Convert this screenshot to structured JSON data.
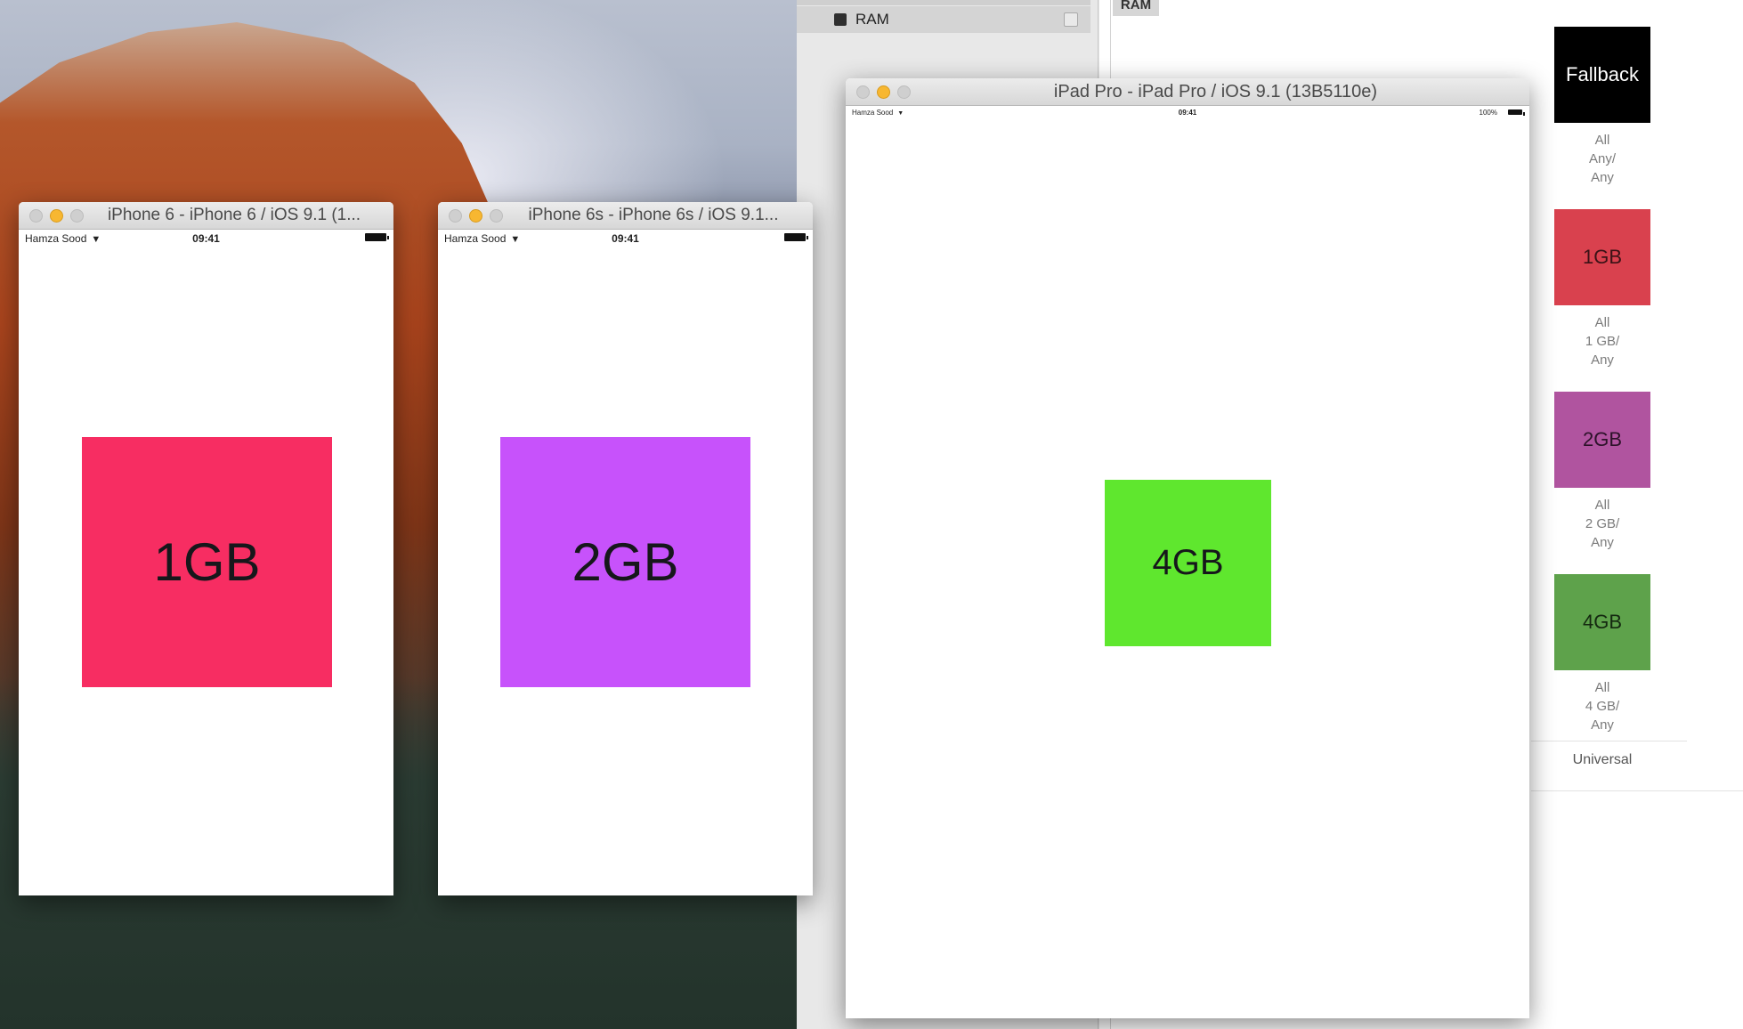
{
  "xcode": {
    "ram_label": "RAM",
    "ram_header": "RAM",
    "slots": [
      {
        "label": "Fallback",
        "caption_lines": [
          "All",
          "Any/",
          "Any"
        ],
        "color": "#000000",
        "text_color": "#ffffff"
      },
      {
        "label": "1GB",
        "caption_lines": [
          "All",
          "1 GB/",
          "Any"
        ],
        "color": "#d9414e",
        "text_color": "#3a1216"
      },
      {
        "label": "2GB",
        "caption_lines": [
          "All",
          "2 GB/",
          "Any"
        ],
        "color": "#b0549f",
        "text_color": "#2c1229"
      },
      {
        "label": "4GB",
        "caption_lines": [
          "All",
          "4 GB/",
          "Any"
        ],
        "color": "#5ea24b",
        "text_color": "#142810"
      }
    ],
    "universal_label": "Universal"
  },
  "simulators": [
    {
      "title": "iPhone 6 - iPhone 6 / iOS 9.1 (1...",
      "carrier": "Hamza Sood",
      "time": "09:41",
      "square_label": "1GB",
      "square_color": "#f72d62"
    },
    {
      "title": "iPhone 6s - iPhone 6s / iOS 9.1...",
      "carrier": "Hamza Sood",
      "time": "09:41",
      "square_label": "2GB",
      "square_color": "#c752fb"
    },
    {
      "title": "iPad Pro - iPad Pro / iOS 9.1 (13B5110e)",
      "carrier": "Hamza Sood",
      "time": "09:41",
      "battery_pct": "100%",
      "square_label": "4GB",
      "square_color": "#5fe72e"
    }
  ]
}
